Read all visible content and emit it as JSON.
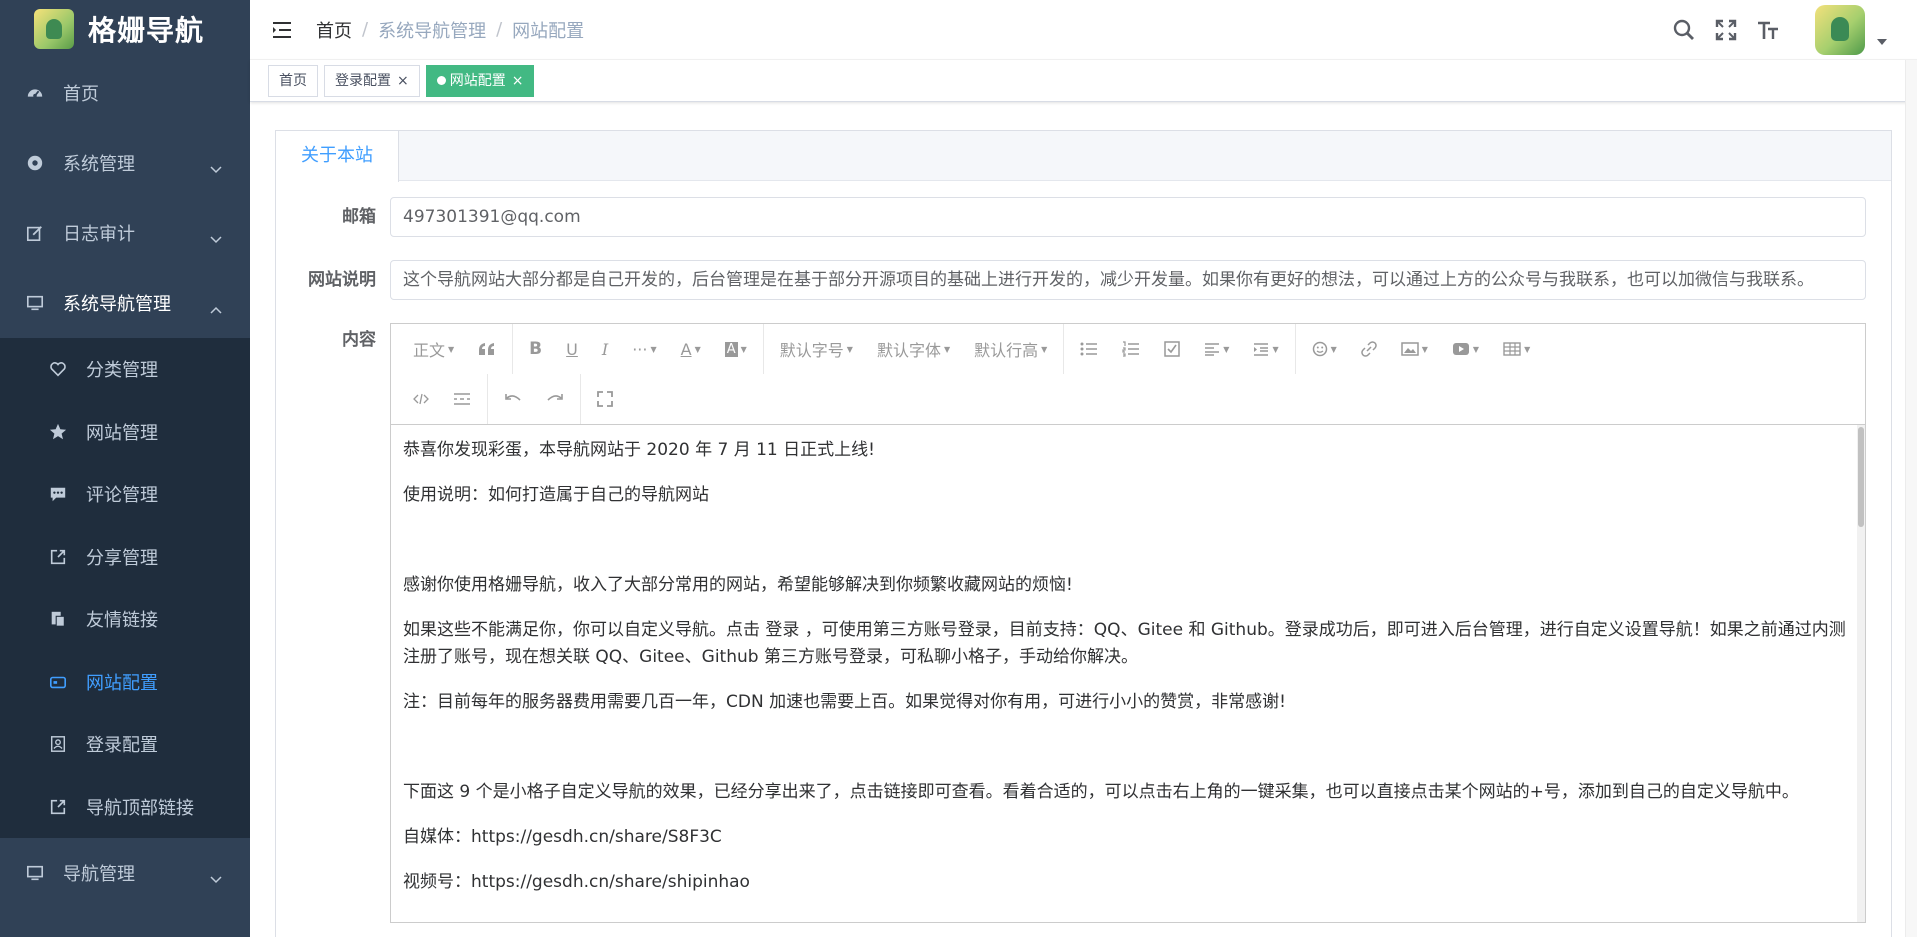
{
  "sidebar": {
    "logo_title": "格姗导航",
    "items": [
      {
        "label": "首页",
        "icon": "dashboard-icon"
      },
      {
        "label": "系统管理",
        "icon": "gear-icon"
      },
      {
        "label": "日志审计",
        "icon": "edit-icon"
      },
      {
        "label": "系统导航管理",
        "icon": "monitor-icon"
      }
    ],
    "sub_items": [
      {
        "label": "分类管理",
        "icon": "heart-icon"
      },
      {
        "label": "网站管理",
        "icon": "star-icon"
      },
      {
        "label": "评论管理",
        "icon": "comment-icon"
      },
      {
        "label": "分享管理",
        "icon": "share-icon"
      },
      {
        "label": "友情链接",
        "icon": "documents-icon"
      },
      {
        "label": "网站配置",
        "icon": "card-icon"
      },
      {
        "label": "登录配置",
        "icon": "portrait-icon"
      },
      {
        "label": "导航顶部链接",
        "icon": "link-out-icon"
      }
    ],
    "bottom_item": {
      "label": "导航管理",
      "icon": "monitor-icon"
    },
    "active_color": "#409eff",
    "bg_color": "#304156"
  },
  "header": {
    "breadcrumb": [
      "首页",
      "系统导航管理",
      "网站配置"
    ],
    "icons": [
      "search-icon",
      "fullscreen-icon",
      "font-size-icon"
    ]
  },
  "tags": [
    {
      "label": "首页"
    },
    {
      "label": "登录配置",
      "close": "×"
    },
    {
      "label": "网站配置",
      "close": "×"
    }
  ],
  "tab": {
    "label": "关于本站"
  },
  "form": {
    "email_label": "邮箱",
    "email_value": "497301391@qq.com",
    "desc_label": "网站说明",
    "desc_value": "这个导航网站大部分都是自己开发的，后台管理是在基于部分开源项目的基础上进行开发的，减少开发量。如果你有更好的想法，可以通过上方的公众号与我联系，也可以加微信与我联系。",
    "content_label": "内容"
  },
  "editor": {
    "toolbar_text": {
      "heading": "正文",
      "font_size": "默认字号",
      "font_family": "默认字体",
      "line_height": "默认行高",
      "more": "···"
    },
    "paragraphs": [
      "恭喜你发现彩蛋，本导航网站于 2020 年 7 月 11 日正式上线!",
      "使用说明：如何打造属于自己的导航网站",
      "",
      "感谢你使用格姗导航，收入了大部分常用的网站，希望能够解决到你频繁收藏网站的烦恼!",
      "如果这些不能满足你，你可以自定义导航。点击 登录 ，可使用第三方账号登录，目前支持：QQ、Gitee 和 Github。登录成功后，即可进入后台管理，进行自定义设置导航！如果之前通过内测注册了账号，现在想关联 QQ、Gitee、Github 第三方账号登录，可私聊小格子，手动给你解决。",
      "注：目前每年的服务器费用需要几百一年，CDN 加速也需要上百。如果觉得对你有用，可进行小小的赞赏，非常感谢!",
      "",
      "下面这 9 个是小格子自定义导航的效果，已经分享出来了，点击链接即可查看。看着合适的，可以点击右上角的一键采集，也可以直接点击某个网站的+号，添加到自己的自定义导航中。",
      "自媒体：https://gesdh.cn/share/S8F3C",
      "视频号：https://gesdh.cn/share/shipinhao"
    ]
  }
}
